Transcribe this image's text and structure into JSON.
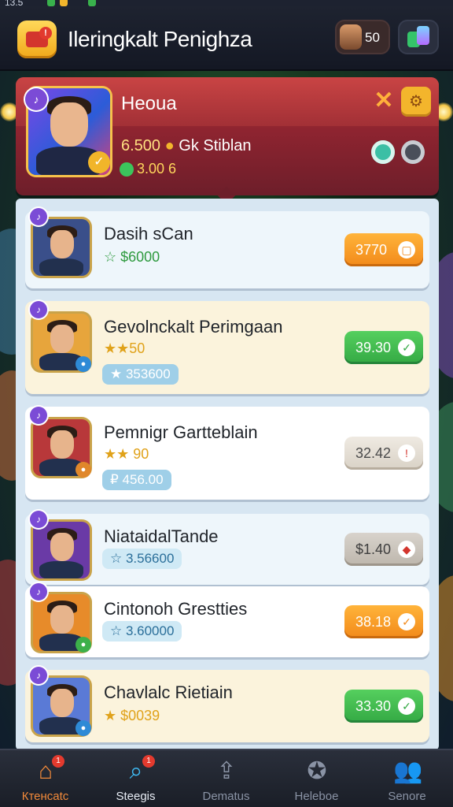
{
  "status_bar": {
    "time": "13.5"
  },
  "header": {
    "title": "Ileringkalt Penighza",
    "app_badge": "!",
    "coins": "50"
  },
  "featured": {
    "name": "Heoua",
    "stat_value": "6.500",
    "stat_label": "Gk Stiblan",
    "sub_value": "3.00 6",
    "corner_icon": "♪"
  },
  "rows": [
    {
      "name": "Dasih sCan",
      "sub": "☆ $6000",
      "pill": "",
      "price": "3770",
      "price_icon": "▢",
      "price_color": "orange",
      "bg": "blue",
      "avatar_bg": "#3a4f8a",
      "mini_color": ""
    },
    {
      "name": "Gevolnckalt Perimgaan",
      "sub": "★★50",
      "pill": "★ 353600",
      "price": "39.30",
      "price_icon": "✓",
      "price_color": "green",
      "bg": "cream",
      "avatar_bg": "#e7a53c",
      "mini_color": "#2e8ad6"
    },
    {
      "name": "Pemnigr Gartteblain",
      "sub": "★★ 90",
      "pill": "₽ 456.00",
      "price": "32.42",
      "price_icon": "!",
      "price_color": "gray",
      "bg": "white",
      "avatar_bg": "#b8383a",
      "mini_color": "#e0872a"
    },
    {
      "name": "NiataidalTande",
      "sub": "",
      "pill": "☆ 3.56600",
      "price": "$1.40",
      "price_icon": "◆",
      "price_color": "graydark",
      "bg": "blue",
      "avatar_bg": "#6a3aa6",
      "mini_color": ""
    },
    {
      "name": "Cintonoh Grestties",
      "sub": "",
      "pill": "☆ 3.60000",
      "price": "38.18",
      "price_icon": "✓",
      "price_color": "orange",
      "bg": "white",
      "avatar_bg": "#e78b2a",
      "mini_color": "#3cb04a"
    },
    {
      "name": "Chavlalc Rietiain",
      "sub": "★ $0039",
      "pill": "",
      "price": "33.30",
      "price_icon": "✓",
      "price_color": "green",
      "bg": "cream",
      "avatar_bg": "#5a7ad6",
      "mini_color": "#2e8ad6"
    }
  ],
  "nav": [
    {
      "label": "Ктенcatc",
      "badge": "1",
      "icon": "home-icon",
      "active": false
    },
    {
      "label": "Steegis",
      "badge": "1",
      "icon": "search-icon",
      "active": true
    },
    {
      "label": "Dematus",
      "badge": "",
      "icon": "upload-icon",
      "active": false
    },
    {
      "label": "Heleboe",
      "badge": "",
      "icon": "badge-icon",
      "active": false
    },
    {
      "label": "Senore",
      "badge": "",
      "icon": "people-icon",
      "active": false
    }
  ],
  "colors": {
    "accent": "#f3b52c",
    "featured_bg": "#a23036",
    "green": "#34a944",
    "orange": "#f28a1a"
  }
}
